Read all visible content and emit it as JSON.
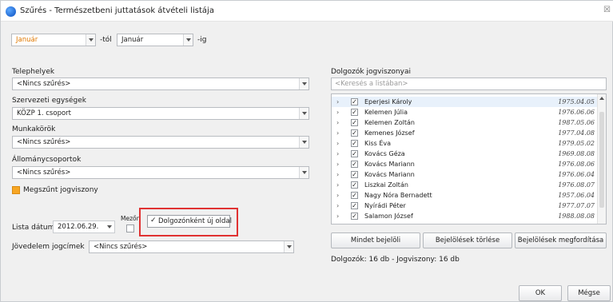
{
  "window": {
    "title": "Szűrés - Természetbeni juttatások átvételi listája",
    "close_glyph": "☒"
  },
  "period": {
    "from_value": "Január",
    "from_suffix": "-tól",
    "to_value": "Január",
    "to_suffix": "-ig"
  },
  "filters": {
    "telephelyek": {
      "label": "Telephelyek",
      "value": "<Nincs szűrés>"
    },
    "szervezeti": {
      "label": "Szervezeti egységek",
      "value": "KÖZP 1. csoport"
    },
    "munkakorok": {
      "label": "Munkakörök",
      "value": "<Nincs szűrés>"
    },
    "allomany": {
      "label": "Állománycsoportok",
      "value": "<Nincs szűrés>"
    },
    "megszunt": {
      "label": "Megszűnt jogviszony"
    }
  },
  "lista": {
    "label": "Lista dátum:",
    "date_value": "2012.06.29.",
    "mezo_label": "Mezőn",
    "dolgozonkent_label": "Dolgozónként új oldal",
    "dolgozonkent_checked": true
  },
  "jovedelem": {
    "label": "Jövedelem jogcímek",
    "value": "<Nincs szűrés>"
  },
  "right": {
    "section_label": "Dolgozók jogviszonyai",
    "search_placeholder": "<Keresés a listában>",
    "employees": [
      {
        "name": "Eperjesi Károly",
        "date": "1975.04.05",
        "checked": true
      },
      {
        "name": "Kelemen Júlia",
        "date": "1976.06.06",
        "checked": true
      },
      {
        "name": "Kelemen Zoltán",
        "date": "1987.05.06",
        "checked": true
      },
      {
        "name": "Kemenes József",
        "date": "1977.04.08",
        "checked": true
      },
      {
        "name": "Kiss Éva",
        "date": "1979.05.02",
        "checked": true
      },
      {
        "name": "Kovács Géza",
        "date": "1969.08.08",
        "checked": true
      },
      {
        "name": "Kovács Mariann",
        "date": "1976.08.06",
        "checked": true
      },
      {
        "name": "Kovács Mariann",
        "date": "1976.06.04",
        "checked": true
      },
      {
        "name": "Liszkai Zoltán",
        "date": "1976.08.07",
        "checked": true
      },
      {
        "name": "Nagy Nóra Bernadett",
        "date": "1957.06.04",
        "checked": true
      },
      {
        "name": "Nyírádi Péter",
        "date": "1977.07.07",
        "checked": true
      },
      {
        "name": "Salamon József",
        "date": "1988.08.08",
        "checked": true
      }
    ],
    "buttons": {
      "select_all": "Mindet bejelöli",
      "clear": "Bejelölések törlése",
      "invert": "Bejelölések megfordítása"
    },
    "summary": "Dolgozók: 16 db - Jogviszony: 16 db"
  },
  "footer": {
    "ok": "OK",
    "cancel": "Mégse"
  },
  "colors": {
    "accent_orange": "#f7a624",
    "highlight_red": "#e03232"
  },
  "icons": {
    "app": "app-icon",
    "close": "close-icon",
    "dropdown": "chevron-down-icon",
    "expand": "chevron-right-icon",
    "check": "checkmark-icon"
  }
}
